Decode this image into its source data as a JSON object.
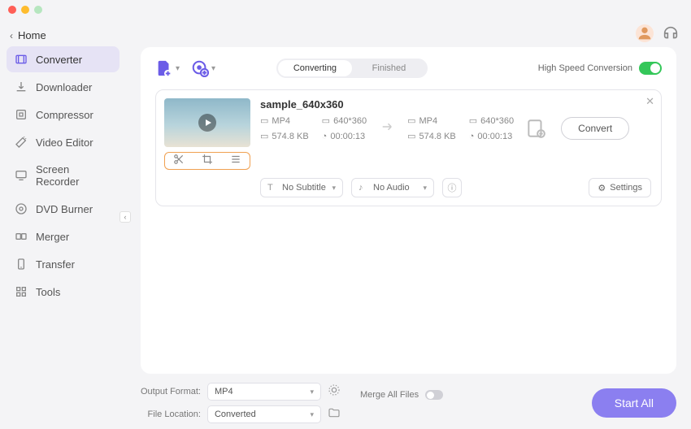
{
  "titlebar": {
    "dots": [
      "close",
      "minimize",
      "maximize"
    ]
  },
  "home_label": "Home",
  "sidebar": {
    "items": [
      {
        "label": "Converter",
        "icon": "film-icon",
        "active": true
      },
      {
        "label": "Downloader",
        "icon": "download-icon"
      },
      {
        "label": "Compressor",
        "icon": "compress-icon"
      },
      {
        "label": "Video Editor",
        "icon": "wand-icon"
      },
      {
        "label": "Screen Recorder",
        "icon": "screen-icon"
      },
      {
        "label": "DVD Burner",
        "icon": "disc-icon"
      },
      {
        "label": "Merger",
        "icon": "merge-icon"
      },
      {
        "label": "Transfer",
        "icon": "transfer-icon"
      },
      {
        "label": "Tools",
        "icon": "grid-icon"
      }
    ]
  },
  "tabs": {
    "converting": "Converting",
    "finished": "Finished"
  },
  "high_speed": {
    "label": "High Speed Conversion",
    "on": true
  },
  "file": {
    "name": "sample_640x360",
    "src": {
      "format": "MP4",
      "dim": "640*360",
      "size": "574.8 KB",
      "dur": "00:00:13"
    },
    "dst": {
      "format": "MP4",
      "dim": "640*360",
      "size": "574.8 KB",
      "dur": "00:00:13"
    },
    "subtitle": "No Subtitle",
    "audio": "No Audio",
    "settings_label": "Settings",
    "convert_label": "Convert"
  },
  "footer": {
    "output_format_label": "Output Format:",
    "output_format_value": "MP4",
    "file_location_label": "File Location:",
    "file_location_value": "Converted",
    "merge_label": "Merge All Files",
    "start_all_label": "Start All"
  }
}
